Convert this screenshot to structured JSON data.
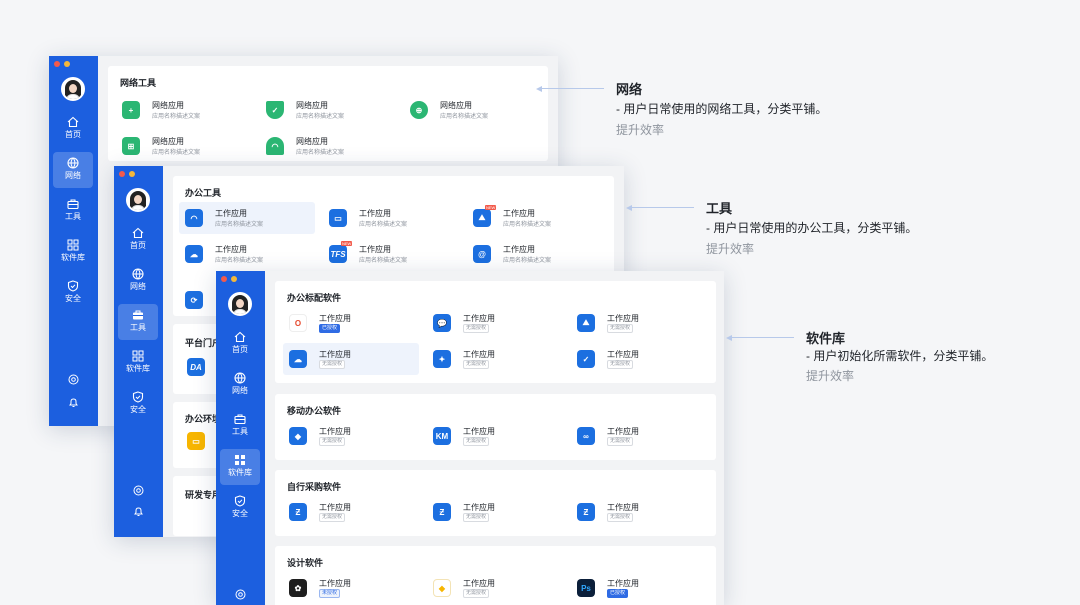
{
  "windows": {
    "network": {
      "nav": [
        {
          "label": "首页",
          "icon": "home-icon"
        },
        {
          "label": "网络",
          "icon": "globe-icon"
        },
        {
          "label": "工具",
          "icon": "toolbox-icon"
        },
        {
          "label": "软件库",
          "icon": "grid-icon"
        },
        {
          "label": "安全",
          "icon": "shield-icon"
        }
      ],
      "active": "网络",
      "section_title": "网络工具",
      "apps": [
        {
          "name": "网络应用",
          "desc": "应用名称描述文案",
          "icon": "medkit-icon",
          "color": "#2bb673"
        },
        {
          "name": "网络应用",
          "desc": "应用名称描述文案",
          "icon": "shield-check-icon",
          "color": "#2bb673"
        },
        {
          "name": "网络应用",
          "desc": "应用名称描述文案",
          "icon": "globe-icon",
          "color": "#2bb673"
        },
        {
          "name": "网络应用",
          "desc": "应用名称描述文案",
          "icon": "network-icon",
          "color": "#2bb673"
        },
        {
          "name": "网络应用",
          "desc": "应用名称描述文案",
          "icon": "wifi-icon",
          "color": "#2bb673"
        }
      ]
    },
    "tools": {
      "nav": [
        {
          "label": "首页",
          "icon": "home-icon"
        },
        {
          "label": "网络",
          "icon": "globe-icon"
        },
        {
          "label": "工具",
          "icon": "toolbox-icon"
        },
        {
          "label": "软件库",
          "icon": "grid-icon"
        },
        {
          "label": "安全",
          "icon": "shield-icon"
        }
      ],
      "active": "工具",
      "section_title": "办公工具",
      "apps": [
        {
          "name": "工作应用",
          "desc": "应用名称描述文案",
          "icon": "wifi-icon",
          "color": "#1c6fe0"
        },
        {
          "name": "工作应用",
          "desc": "应用名称描述文案",
          "icon": "printer-icon",
          "color": "#1c6fe0"
        },
        {
          "name": "工作应用",
          "desc": "应用名称描述文案",
          "icon": "mountain-icon",
          "color": "#1c6fe0",
          "new": "NEW"
        },
        {
          "name": "工作应用",
          "desc": "应用名称描述文案",
          "icon": "cloud-folder-icon",
          "color": "#1c6fe0"
        },
        {
          "name": "工作应用",
          "desc": "应用名称描述文案",
          "icon": "tfs-icon",
          "color": "#1c6fe0",
          "text": "TFS",
          "new": "NEW"
        },
        {
          "name": "工作应用",
          "desc": "应用名称描述文案",
          "icon": "at-icon",
          "color": "#1c6fe0"
        }
      ],
      "section2_title": "平台门户",
      "section2_icon_text": "DA",
      "section3_title": "办公环境",
      "section4_title": "研发专用"
    },
    "software": {
      "nav": [
        {
          "label": "首页",
          "icon": "home-icon"
        },
        {
          "label": "网络",
          "icon": "globe-icon"
        },
        {
          "label": "工具",
          "icon": "toolbox-icon"
        },
        {
          "label": "软件库",
          "icon": "grid-icon"
        },
        {
          "label": "安全",
          "icon": "shield-icon"
        }
      ],
      "active": "软件库",
      "sections": [
        {
          "title": "办公标配软件",
          "apps": [
            {
              "name": "工作应用",
              "badge": "已授权",
              "badge_style": "blue",
              "icon": "office-icon",
              "color": "#e6492d",
              "text": "O"
            },
            {
              "name": "工作应用",
              "badge": "无需授权",
              "icon": "chat-icon",
              "color": "#1c6fe0"
            },
            {
              "name": "工作应用",
              "badge": "无需授权",
              "icon": "mountain-icon",
              "color": "#1c6fe0"
            },
            {
              "name": "工作应用",
              "badge": "无需授权",
              "icon": "cloud-folder-icon",
              "color": "#1c6fe0"
            },
            {
              "name": "工作应用",
              "badge": "无需授权",
              "icon": "compass-icon",
              "color": "#1c6fe0"
            },
            {
              "name": "工作应用",
              "badge": "无需授权",
              "icon": "shield-icon",
              "color": "#1c6fe0"
            }
          ]
        },
        {
          "title": "移动办公软件",
          "apps": [
            {
              "name": "工作应用",
              "badge": "无需授权",
              "icon": "diamond-icon",
              "color": "#1c6fe0"
            },
            {
              "name": "工作应用",
              "badge": "无需授权",
              "icon": "km-icon",
              "color": "#1c6fe0",
              "text": "KM"
            },
            {
              "name": "工作应用",
              "badge": "无需授权",
              "icon": "link-icon",
              "color": "#1c6fe0"
            }
          ]
        },
        {
          "title": "自行采购软件",
          "apps": [
            {
              "name": "工作应用",
              "badge": "无需授权",
              "icon": "z-icon",
              "color": "#1c6fe0"
            },
            {
              "name": "工作应用",
              "badge": "无需授权",
              "icon": "z-icon",
              "color": "#1c6fe0"
            },
            {
              "name": "工作应用",
              "badge": "无需授权",
              "icon": "z-icon",
              "color": "#1c6fe0"
            }
          ]
        },
        {
          "title": "设计软件",
          "apps": [
            {
              "name": "工作应用",
              "badge": "未授权",
              "badge_style": "out",
              "icon": "figma-icon",
              "color": "#1e1e1e"
            },
            {
              "name": "工作应用",
              "badge": "无需授权",
              "icon": "sketch-icon",
              "color": "#f7b500"
            },
            {
              "name": "工作应用",
              "badge": "已授权",
              "badge_style": "blue",
              "icon": "photoshop-icon",
              "color": "#0b1f3a",
              "text": "Ps"
            }
          ]
        }
      ]
    }
  },
  "notes": [
    {
      "title": "网络",
      "desc": "-  用户日常使用的网络工具，分类平铺。",
      "sub": "提升效率"
    },
    {
      "title": "工具",
      "desc": "-  用户日常使用的办公工具，分类平铺。",
      "sub": "提升效率"
    },
    {
      "title": "软件库",
      "desc": "-  用户初始化所需软件，分类平铺。",
      "sub": "提升效率"
    }
  ],
  "colors": {
    "sidebar": "#1c5fdf",
    "accent": "#2f6be4",
    "green": "#2bb673"
  }
}
